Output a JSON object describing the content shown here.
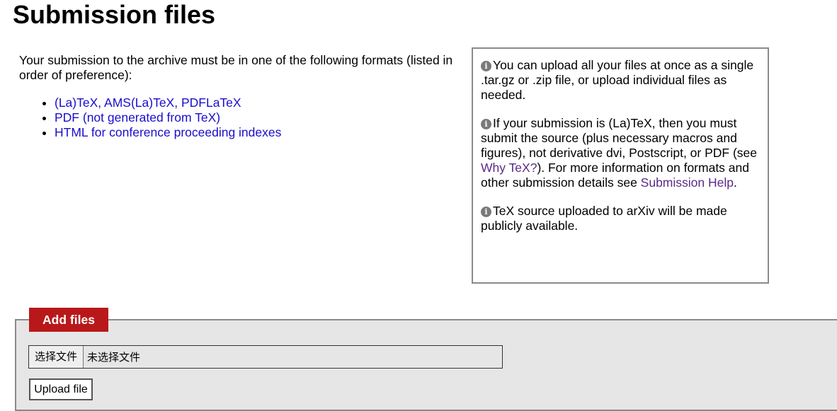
{
  "page": {
    "title": "Submission files"
  },
  "intro": {
    "text": "Your submission to the archive must be in one of the following formats (listed in order of preference):"
  },
  "formats": [
    {
      "label": "(La)TeX, AMS(La)TeX, PDFLaTeX"
    },
    {
      "label": "PDF (not generated from TeX)"
    },
    {
      "label": "HTML for conference proceeding indexes"
    }
  ],
  "info": {
    "icon": "info-circle-icon",
    "p1": "You can upload all your files at once as a single .tar.gz or .zip file, or upload individual files as needed.",
    "p2_a": "If your submission is (La)TeX, then you must submit the source (plus necessary macros and figures), not derivative dvi, Postscript, or PDF (see ",
    "p2_link1": "Why TeX?",
    "p2_b": "). For more information on formats and other submission details see ",
    "p2_link2": "Submission Help",
    "p2_c": ".",
    "p3": "TeX source uploaded to arXiv will be made publicly available."
  },
  "upload": {
    "legend": "Add files",
    "choose_label": "选择文件",
    "no_file_text": "未选择文件",
    "upload_label": "Upload file"
  },
  "colors": {
    "link": "#1a0dcb",
    "visited_link": "#5b2a86",
    "legend_bg": "#b9181a",
    "fieldset_bg": "#e6e6e6"
  }
}
